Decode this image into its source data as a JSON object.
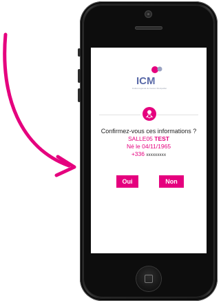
{
  "app": {
    "logo_text": "ICM",
    "logo_subtitle": "Institut régional du Cancer Montpellier"
  },
  "confirmation": {
    "question": "Confirmez-vous ces informations ?",
    "name_first": "SALLE05",
    "name_last": "TEST",
    "birth": "Né le 04/11/1965",
    "phone_prefix": "+336",
    "phone_masked": "xxxxxxxxx"
  },
  "buttons": {
    "yes": "Oui",
    "no": "Non"
  },
  "colors": {
    "accent": "#e5007e",
    "logo_blue": "#5a6aa8",
    "logo_gray": "#9aa3c2",
    "text": "#222222"
  },
  "icons": {
    "arrow": "curved-arrow-icon",
    "user_badge": "user-shield-icon"
  }
}
